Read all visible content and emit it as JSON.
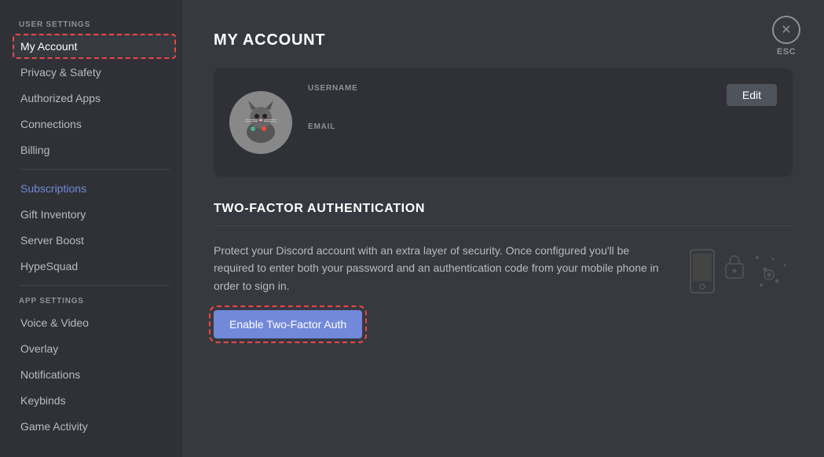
{
  "sidebar": {
    "user_settings_header": "USER SETTINGS",
    "app_settings_header": "APP SETTINGS",
    "items": {
      "my_account": "My Account",
      "privacy_safety": "Privacy & Safety",
      "authorized_apps": "Authorized Apps",
      "connections": "Connections",
      "billing": "Billing",
      "subscriptions": "Subscriptions",
      "gift_inventory": "Gift Inventory",
      "server_boost": "Server Boost",
      "hypesquad": "HypeSquad",
      "voice_video": "Voice & Video",
      "overlay": "Overlay",
      "notifications": "Notifications",
      "keybinds": "Keybinds",
      "game_activity": "Game Activity"
    }
  },
  "main": {
    "page_title": "MY ACCOUNT",
    "account": {
      "username_label": "USERNAME",
      "email_label": "EMAIL",
      "edit_button": "Edit"
    },
    "two_factor": {
      "section_title": "TWO-FACTOR AUTHENTICATION",
      "description": "Protect your Discord account with an extra layer of security. Once configured you'll be required to enter both your password and an authentication code from your mobile phone in order to sign in.",
      "enable_button": "Enable Two-Factor Auth"
    },
    "esc": {
      "label": "ESC",
      "icon": "✕"
    }
  }
}
